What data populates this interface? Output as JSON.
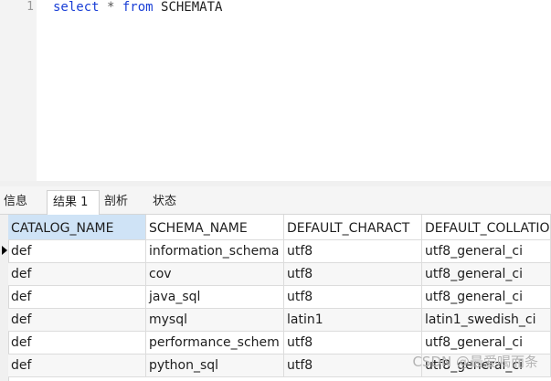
{
  "editor": {
    "line_number": "1",
    "code": {
      "kw1": "select",
      "star": " * ",
      "kw2": "from",
      "rest": " SCHEMATA"
    }
  },
  "tabs": [
    "信息",
    "结果 1",
    "剖析",
    "状态"
  ],
  "active_tab": "结果 1",
  "table": {
    "columns": [
      "CATALOG_NAME",
      "SCHEMA_NAME",
      "DEFAULT_CHARACT",
      "DEFAULT_COLLATIO"
    ],
    "rows": [
      [
        "def",
        "information_schema",
        "utf8",
        "utf8_general_ci"
      ],
      [
        "def",
        "cov",
        "utf8",
        "utf8_general_ci"
      ],
      [
        "def",
        "java_sql",
        "utf8",
        "utf8_general_ci"
      ],
      [
        "def",
        "mysql",
        "latin1",
        "latin1_swedish_ci"
      ],
      [
        "def",
        "performance_schem",
        "utf8",
        "utf8_general_ci"
      ],
      [
        "def",
        "python_sql",
        "utf8",
        "utf8_general_ci"
      ]
    ]
  },
  "watermark": "CSDN @最爱喝而条"
}
